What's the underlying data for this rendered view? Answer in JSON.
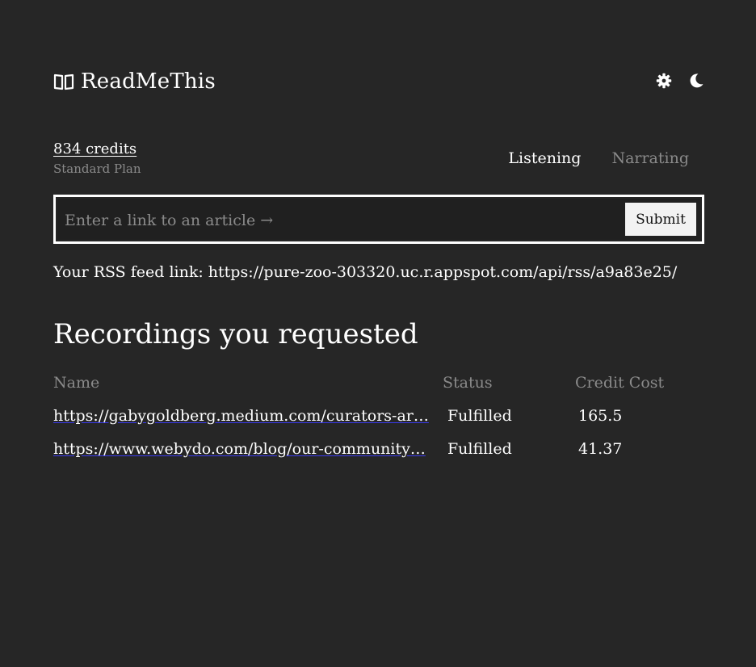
{
  "brand": {
    "name": "ReadMeThis",
    "icon": "open-book-icon"
  },
  "header": {
    "settings_icon": "gear-icon",
    "theme_icon": "moon-icon"
  },
  "account": {
    "credits": "834 credits",
    "plan": "Standard Plan"
  },
  "tabs": [
    {
      "label": "Listening",
      "active": true
    },
    {
      "label": "Narrating",
      "active": false
    }
  ],
  "form": {
    "placeholder": "Enter a link to an article →",
    "value": "",
    "submit_label": "Submit"
  },
  "rss": {
    "text": "Your RSS feed link: https://pure-zoo-303320.uc.r.appspot.com/api/rss/a9a83e25/"
  },
  "recordings": {
    "title": "Recordings you requested",
    "columns": [
      "Name",
      "Status",
      "Credit Cost"
    ],
    "rows": [
      {
        "name": "https://gabygoldberg.medium.com/curators-ar…",
        "status": "Fulfilled",
        "cost": "165.5"
      },
      {
        "name": "https://www.webydo.com/blog/our-community…",
        "status": "Fulfilled",
        "cost": "41.37"
      }
    ]
  },
  "colors": {
    "background": "#262626",
    "text": "#ffffff",
    "muted": "#8a8a8a",
    "link_underline": "#3a3af0"
  }
}
